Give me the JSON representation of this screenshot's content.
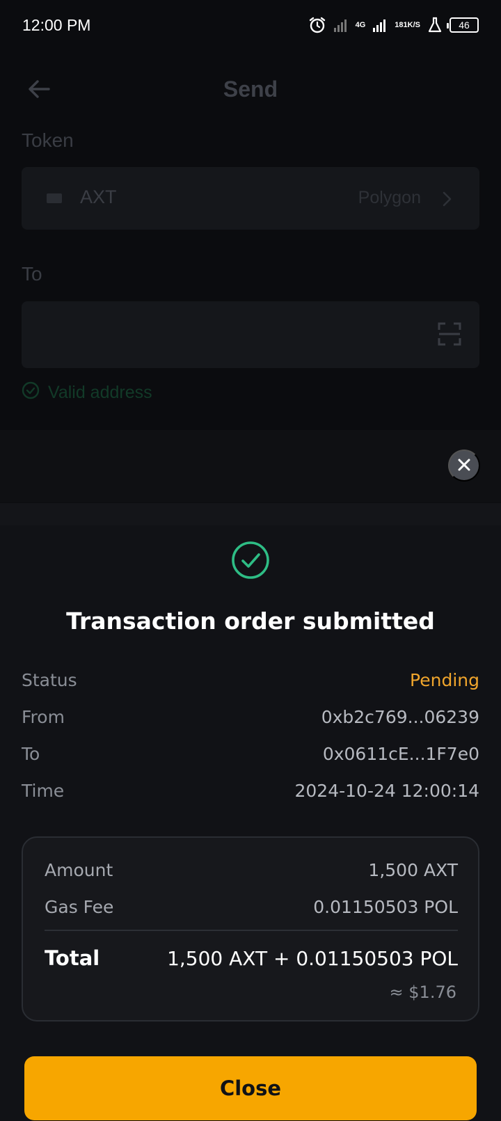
{
  "status_bar": {
    "time": "12:00 PM",
    "network_type": "4G",
    "net_speed_value": "181",
    "net_speed_unit": "K/S",
    "battery": "46"
  },
  "background_page": {
    "title": "Send",
    "token_label": "Token",
    "token_name": "AXT",
    "network": "Polygon",
    "to_label": "To",
    "valid_address": "Valid address"
  },
  "sheet": {
    "title": "Transaction order submitted",
    "details": [
      {
        "key": "Status",
        "value": "Pending"
      },
      {
        "key": "From",
        "value": "0xb2c769...06239"
      },
      {
        "key": "To",
        "value": "0x0611cE...1F7e0"
      },
      {
        "key": "Time",
        "value": "2024-10-24 12:00:14"
      }
    ],
    "summary": {
      "amount_label": "Amount",
      "amount_value": "1,500 AXT",
      "gas_label": "Gas Fee",
      "gas_value": "0.01150503 POL",
      "total_label": "Total",
      "total_value": "1,500 AXT + 0.01150503 POL",
      "total_usd": "≈ $1.76"
    },
    "close_label": "Close"
  },
  "colors": {
    "accent": "#f7a600",
    "pending": "#f0a52c",
    "success": "#2ebd85"
  }
}
